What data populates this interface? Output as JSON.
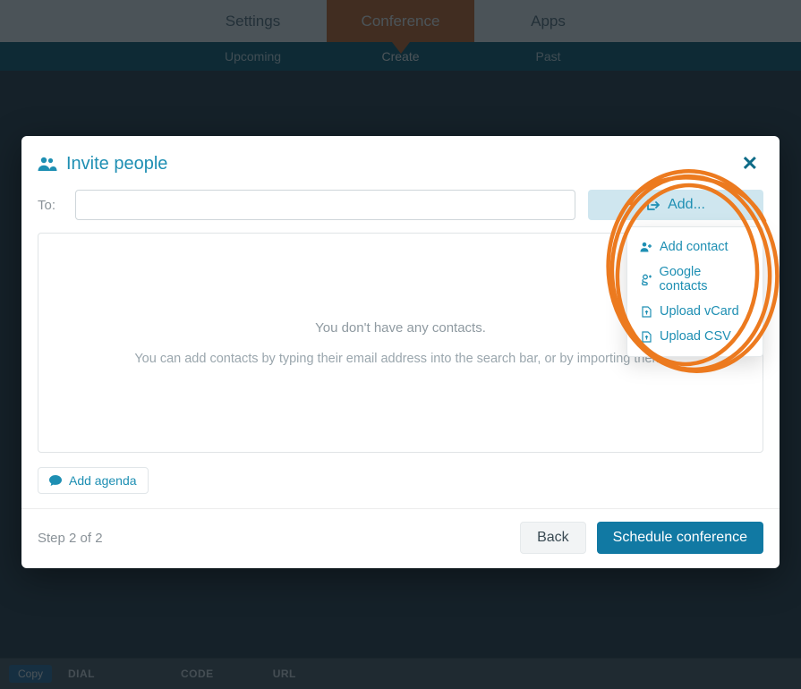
{
  "topnav": {
    "settings": "Settings",
    "conference": "Conference",
    "apps": "Apps"
  },
  "subnav": {
    "upcoming": "Upcoming",
    "create": "Create",
    "past": "Past"
  },
  "modal": {
    "title": "Invite people",
    "to_label": "To:",
    "search_placeholder": "",
    "add_label": "Add...",
    "empty_line1": "You don't have any contacts.",
    "empty_line2": "You can add contacts by typing their email address into the search bar, or by importing them.",
    "agenda_label": "Add agenda",
    "step_text": "Step 2 of 2",
    "back_label": "Back",
    "schedule_label": "Schedule conference"
  },
  "dropdown": {
    "add_contact": "Add contact",
    "google_contacts": "Google contacts",
    "upload_vcard": "Upload vCard",
    "upload_csv": "Upload CSV"
  },
  "bottombar": {
    "copy": "Copy",
    "dial": "DIAL",
    "code": "CODE",
    "url": "URL"
  },
  "annotation": {
    "type": "hand-drawn-circle",
    "color": "#ec7a1f"
  }
}
